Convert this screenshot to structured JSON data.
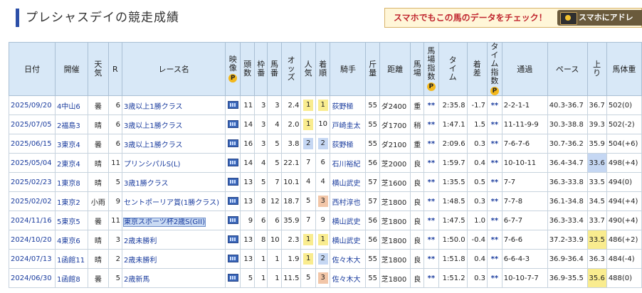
{
  "page": {
    "title": "プレシャスデイの競走成績",
    "banner_text": "スマホでもこの馬のデータをチェック！",
    "banner_button": "スマホにアドレ",
    "pp_label": "P"
  },
  "headers": [
    "日付",
    "開催",
    "天気",
    "R",
    "レース名",
    "映像",
    "頭数",
    "枠番",
    "馬番",
    "オッズ",
    "人気",
    "着順",
    "騎手",
    "斤量",
    "距離",
    "馬場",
    "馬場指数",
    "タイム",
    "着差",
    "タイム指数",
    "通過",
    "ペース",
    "上り",
    "馬体重"
  ],
  "rows": [
    {
      "date": "2025/09/20",
      "kaisai": "4中山6",
      "weather": "曇",
      "race_no": "6",
      "race_name": "3歳以上1勝クラス",
      "heads": "11",
      "waku": "3",
      "umaban": "3",
      "odds": "2.4",
      "ninki": "1",
      "chakujun": "1",
      "jockey": "荻野極",
      "kinryo": "55",
      "distance": "ダ2400",
      "baba": "重",
      "baba_idx": "**",
      "time": "2:35.8",
      "margin": "-1.7",
      "time_idx": "**",
      "passing": "2-2-1-1",
      "pace": "40.3-36.7",
      "agari": "36.7",
      "weight": "502(0)"
    },
    {
      "date": "2025/07/05",
      "kaisai": "2福島3",
      "weather": "晴",
      "race_no": "6",
      "race_name": "3歳以上1勝クラス",
      "heads": "14",
      "waku": "3",
      "umaban": "4",
      "odds": "2.0",
      "ninki": "1",
      "chakujun": "10",
      "jockey": "戸崎圭太",
      "kinryo": "55",
      "distance": "ダ1700",
      "baba": "稍",
      "baba_idx": "**",
      "time": "1:47.1",
      "margin": "1.5",
      "time_idx": "**",
      "passing": "11-11-9-9",
      "pace": "30.3-38.8",
      "agari": "39.3",
      "weight": "502(-2)"
    },
    {
      "date": "2025/06/15",
      "kaisai": "3東京4",
      "weather": "曇",
      "race_no": "6",
      "race_name": "3歳以上1勝クラス",
      "heads": "16",
      "waku": "3",
      "umaban": "5",
      "odds": "3.8",
      "ninki": "2",
      "chakujun": "2",
      "jockey": "荻野極",
      "kinryo": "55",
      "distance": "ダ2100",
      "baba": "重",
      "baba_idx": "**",
      "time": "2:09.6",
      "margin": "0.3",
      "time_idx": "**",
      "passing": "7-6-7-6",
      "pace": "30.7-36.2",
      "agari": "35.9",
      "weight": "504(+6)"
    },
    {
      "date": "2025/05/04",
      "kaisai": "2東京4",
      "weather": "晴",
      "race_no": "11",
      "race_name": "プリンシパルS(L)",
      "heads": "14",
      "waku": "4",
      "umaban": "5",
      "odds": "22.1",
      "ninki": "7",
      "chakujun": "6",
      "jockey": "石川裕紀",
      "kinryo": "56",
      "distance": "芝2000",
      "baba": "良",
      "baba_idx": "**",
      "time": "1:59.7",
      "margin": "0.4",
      "time_idx": "**",
      "passing": "10-10-11",
      "pace": "36.4-34.7",
      "agari": "33.6",
      "weight": "498(+4)"
    },
    {
      "date": "2025/02/23",
      "kaisai": "1東京8",
      "weather": "晴",
      "race_no": "5",
      "race_name": "3歳1勝クラス",
      "heads": "13",
      "waku": "5",
      "umaban": "7",
      "odds": "10.1",
      "ninki": "4",
      "chakujun": "4",
      "jockey": "横山武史",
      "kinryo": "57",
      "distance": "芝1600",
      "baba": "良",
      "baba_idx": "**",
      "time": "1:35.5",
      "margin": "0.5",
      "time_idx": "**",
      "passing": "7-7",
      "pace": "36.3-33.8",
      "agari": "33.5",
      "weight": "494(0)"
    },
    {
      "date": "2025/02/02",
      "kaisai": "1東京2",
      "weather": "小雨",
      "race_no": "9",
      "race_name": "セントポーリア賞(1勝クラス)",
      "heads": "13",
      "waku": "8",
      "umaban": "12",
      "odds": "18.7",
      "ninki": "5",
      "chakujun": "3",
      "jockey": "西村淳也",
      "kinryo": "57",
      "distance": "芝1800",
      "baba": "良",
      "baba_idx": "**",
      "time": "1:48.5",
      "margin": "0.3",
      "time_idx": "**",
      "passing": "7-7-8",
      "pace": "36.1-34.8",
      "agari": "34.5",
      "weight": "494(+4)"
    },
    {
      "date": "2024/11/16",
      "kaisai": "5東京5",
      "weather": "曇",
      "race_no": "11",
      "race_name": "東京スポーツ杯2歳S(GII)",
      "heads": "9",
      "waku": "6",
      "umaban": "6",
      "odds": "35.9",
      "ninki": "7",
      "chakujun": "9",
      "jockey": "横山武史",
      "kinryo": "56",
      "distance": "芝1800",
      "baba": "良",
      "baba_idx": "**",
      "time": "1:47.5",
      "margin": "1.0",
      "time_idx": "**",
      "passing": "6-7-7",
      "pace": "36.3-33.4",
      "agari": "33.7",
      "weight": "490(+4)"
    },
    {
      "date": "2024/10/20",
      "kaisai": "4東京6",
      "weather": "晴",
      "race_no": "3",
      "race_name": "2歳未勝利",
      "heads": "13",
      "waku": "8",
      "umaban": "10",
      "odds": "2.3",
      "ninki": "1",
      "chakujun": "1",
      "jockey": "横山武史",
      "kinryo": "56",
      "distance": "芝1800",
      "baba": "良",
      "baba_idx": "**",
      "time": "1:50.0",
      "margin": "-0.4",
      "time_idx": "**",
      "passing": "7-6-6",
      "pace": "37.2-33.9",
      "agari": "33.5",
      "weight": "486(+2)"
    },
    {
      "date": "2024/07/13",
      "kaisai": "1函館11",
      "weather": "晴",
      "race_no": "2",
      "race_name": "2歳未勝利",
      "heads": "13",
      "waku": "1",
      "umaban": "1",
      "odds": "1.9",
      "ninki": "1",
      "chakujun": "2",
      "jockey": "佐々木大",
      "kinryo": "55",
      "distance": "芝1800",
      "baba": "良",
      "baba_idx": "**",
      "time": "1:51.8",
      "margin": "0.4",
      "time_idx": "**",
      "passing": "6-6-4-3",
      "pace": "36.9-36.4",
      "agari": "36.3",
      "weight": "484(-4)"
    },
    {
      "date": "2024/06/30",
      "kaisai": "1函館8",
      "weather": "曇",
      "race_no": "5",
      "race_name": "2歳新馬",
      "heads": "5",
      "waku": "1",
      "umaban": "1",
      "odds": "11.5",
      "ninki": "5",
      "chakujun": "3",
      "jockey": "佐々木大",
      "kinryo": "55",
      "distance": "芝1800",
      "baba": "良",
      "baba_idx": "**",
      "time": "1:51.2",
      "margin": "0.3",
      "time_idx": "**",
      "passing": "10-10-7-7",
      "pace": "36.9-35.5",
      "agari": "35.6",
      "weight": "488(0)"
    }
  ],
  "highlights": {
    "rank_colors": {
      "1": "#f9ec8f",
      "2": "#c5d7f3",
      "3": "#f2c6a8"
    },
    "agari_top_rows": [
      0,
      2,
      4,
      7,
      9
    ],
    "agari_second_rows": [
      3,
      8
    ],
    "selected_race_row": 6
  }
}
